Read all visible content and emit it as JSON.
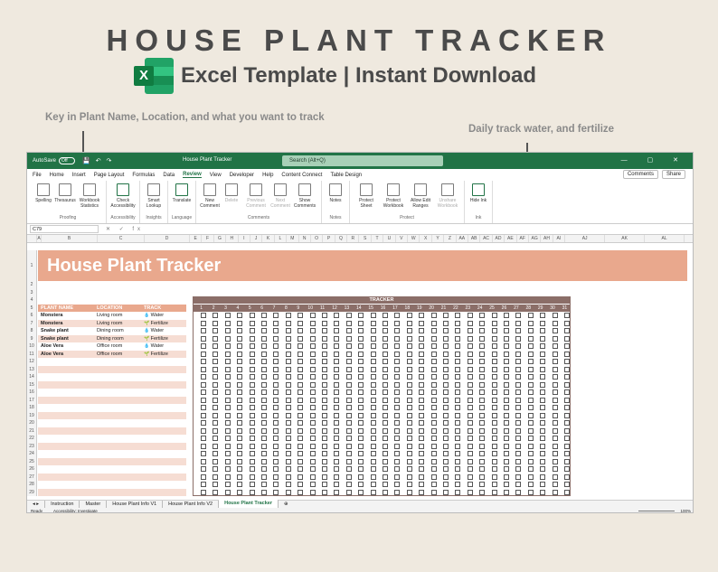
{
  "header": {
    "title": "HOUSE PLANT TRACKER",
    "subtitle": "Excel Template | Instant Download",
    "logo_letter": "X"
  },
  "annotations": {
    "left": "Key in Plant Name, Location, and what you want to track",
    "right": "Daily track water, and fertilize"
  },
  "window": {
    "autosave_label": "AutoSave",
    "autosave_state": "Off",
    "doc_title": "House Plant Tracker",
    "search_placeholder": "Search (Alt+Q)",
    "controls": "— ▢ ✕"
  },
  "menu": {
    "items": [
      "File",
      "Home",
      "Insert",
      "Page Layout",
      "Formulas",
      "Data",
      "Review",
      "View",
      "Developer",
      "Help",
      "Content Connect",
      "Table Design"
    ],
    "active": "Review",
    "comments": "Comments",
    "share": "Share"
  },
  "ribbon": {
    "groups": [
      {
        "label": "Proofing",
        "buttons": [
          "Spelling",
          "Thesaurus",
          "Workbook Statistics"
        ]
      },
      {
        "label": "Accessibility",
        "buttons": [
          "Check Accessibility"
        ]
      },
      {
        "label": "Insights",
        "buttons": [
          "Smart Lookup"
        ]
      },
      {
        "label": "Language",
        "buttons": [
          "Translate"
        ]
      },
      {
        "label": "Comments",
        "buttons": [
          "New Comment",
          "Delete",
          "Previous Comment",
          "Next Comment",
          "Show Comments"
        ]
      },
      {
        "label": "Notes",
        "buttons": [
          "Notes"
        ]
      },
      {
        "label": "Protect",
        "buttons": [
          "Protect Sheet",
          "Protect Workbook",
          "Allow Edit Ranges",
          "Unshare Workbook"
        ]
      },
      {
        "label": "Ink",
        "buttons": [
          "Hide Ink"
        ]
      }
    ]
  },
  "formula_bar": {
    "cell_ref": "C79",
    "fx": "✕ ✓ fx"
  },
  "columns": [
    "A",
    "B",
    "C",
    "D",
    "E",
    "F",
    "G",
    "H",
    "I",
    "J",
    "K",
    "L",
    "M",
    "N",
    "O",
    "P",
    "Q",
    "R",
    "S",
    "T",
    "U",
    "V",
    "W",
    "X",
    "Y",
    "Z",
    "AA",
    "AB",
    "AC",
    "AD",
    "AE",
    "AF",
    "AG",
    "AH",
    "AI",
    "AJ",
    "AK",
    "AL"
  ],
  "sheet": {
    "banner_title": "House Plant Tracker",
    "table_headers": [
      "PLANT NAME",
      "LOCATION",
      "TRACK"
    ],
    "tracker_label": "TRACKER",
    "days": [
      "1",
      "2",
      "3",
      "4",
      "5",
      "6",
      "7",
      "8",
      "9",
      "10",
      "11",
      "12",
      "13",
      "14",
      "15",
      "16",
      "17",
      "18",
      "19",
      "20",
      "21",
      "22",
      "23",
      "24",
      "25",
      "26",
      "27",
      "28",
      "29",
      "30",
      "31"
    ],
    "plants": [
      {
        "name": "Monstera",
        "location": "Living room",
        "track": "Water"
      },
      {
        "name": "Monstera",
        "location": "Living room",
        "track": "Fertilize"
      },
      {
        "name": "Snake plant",
        "location": "Dining room",
        "track": "Water"
      },
      {
        "name": "Snake plant",
        "location": "Dining room",
        "track": "Fertilize"
      },
      {
        "name": "Aloe Vera",
        "location": "Office room",
        "track": "Water"
      },
      {
        "name": "Aloe Vera",
        "location": "Office room",
        "track": "Fertilize"
      }
    ],
    "row_numbers": [
      "1",
      "2",
      "3",
      "4",
      "5",
      "6",
      "7",
      "8",
      "9",
      "10",
      "11",
      "12",
      "13",
      "14",
      "15",
      "16",
      "17",
      "18",
      "19",
      "20",
      "21",
      "22",
      "23",
      "24",
      "25",
      "26",
      "27",
      "28",
      "29"
    ]
  },
  "tabs": {
    "items": [
      "Instruction",
      "Master",
      "House Plant Info V1",
      "House Plant Info V2",
      "House Plant Tracker"
    ],
    "active": "House Plant Tracker"
  },
  "status": {
    "ready": "Ready",
    "accessibility": "Accessibility: Investigate",
    "zoom": "100%"
  }
}
